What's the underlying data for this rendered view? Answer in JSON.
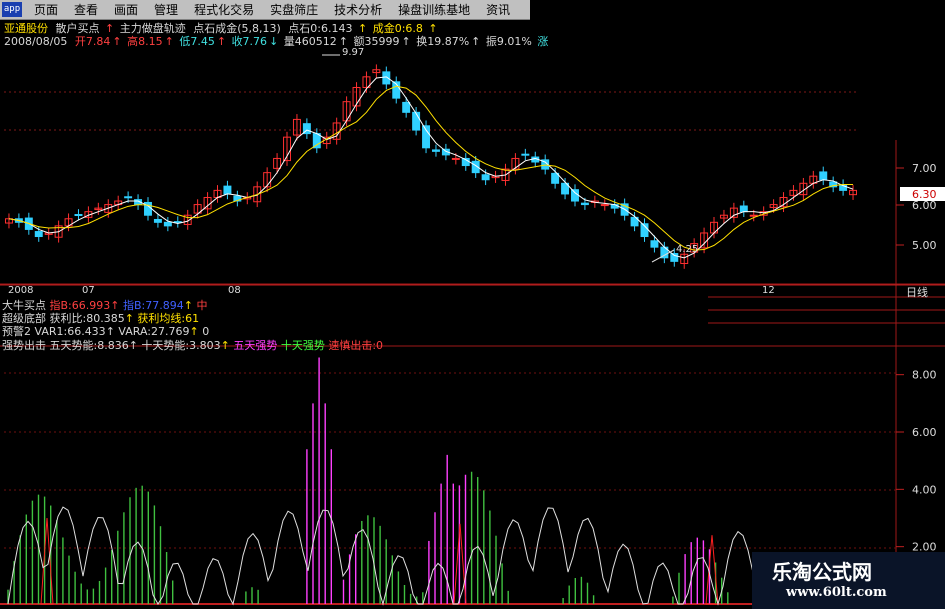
{
  "menu": {
    "logo": "app",
    "items": [
      "页面",
      "查看",
      "画面",
      "管理",
      "程式化交易",
      "实盘筛庄",
      "技术分析",
      "操盘训练基地",
      "资讯"
    ]
  },
  "header": {
    "stock_name": "亚通股份",
    "indicator_name": "散户买点",
    "overlay1": "主力做盘轨迹",
    "overlay2": "点石成金(5,8,13)",
    "dianshi": "点石0:6.143",
    "chengjin": "成金0:6.8",
    "date": "2008/08/05",
    "open": "开7.84",
    "high": "高8.15",
    "low": "低7.45",
    "close": "收7.76",
    "volume": "量460512",
    "amount": "额35999",
    "turnover": "换19.87%",
    "amplitude": "振9.01%",
    "extra": "涨"
  },
  "chart_data": [
    {
      "type": "candlestick",
      "title": "",
      "price_ticks": [
        "7.00",
        "6.00",
        "5.00"
      ],
      "current_price_label": "6.30",
      "annotations": {
        "high_label": "9.97",
        "low_label": "4.25"
      },
      "time_labels": [
        "2008",
        "07",
        "08",
        "12"
      ],
      "period_label": "日线",
      "ma_series": [
        {
          "name": "MA5",
          "color": "#ffffff"
        },
        {
          "name": "MA10",
          "color": "#ffe000"
        }
      ],
      "closes": [
        5.5,
        5.4,
        5.2,
        5.0,
        5.1,
        5.3,
        5.5,
        5.6,
        5.7,
        5.8,
        5.9,
        6.0,
        6.1,
        5.9,
        5.6,
        5.4,
        5.3,
        5.4,
        5.6,
        5.9,
        6.1,
        6.3,
        6.2,
        6.0,
        6.1,
        6.4,
        6.8,
        7.2,
        7.8,
        8.3,
        7.9,
        7.5,
        7.8,
        8.2,
        8.8,
        9.2,
        9.5,
        9.7,
        9.3,
        8.9,
        8.5,
        8.0,
        7.5,
        7.4,
        7.3,
        7.2,
        7.0,
        6.8,
        6.6,
        6.7,
        6.9,
        7.2,
        7.3,
        7.1,
        6.9,
        6.5,
        6.2,
        6.0,
        5.9,
        6.0,
        5.9,
        5.8,
        5.6,
        5.3,
        5.0,
        4.7,
        4.4,
        4.3,
        4.5,
        4.8,
        5.1,
        5.4,
        5.6,
        5.8,
        5.7,
        5.6,
        5.7,
        5.9,
        6.1,
        6.3,
        6.5,
        6.7,
        6.6,
        6.4,
        6.3,
        6.3
      ]
    },
    {
      "type": "bar",
      "title": "",
      "ylim": [
        0,
        9
      ],
      "y_ticks": [
        "8.00",
        "6.00",
        "4.00",
        "2.00"
      ],
      "series": [
        {
          "name": "五天势能",
          "color": "#ff40ff"
        },
        {
          "name": "十天势能",
          "color": "#40ff40"
        },
        {
          "name": "速慎出击",
          "color": "#ff2020"
        }
      ]
    }
  ],
  "panel2": {
    "name": "大牛买点",
    "v1": "指B:66.993",
    "v2": "指B:77.894",
    "v3": "中"
  },
  "panel3": {
    "name": "超级底部",
    "profit": "获利比:80.385",
    "avg": "获利均线:61"
  },
  "panel4": {
    "name": "预警2",
    "var1": "VAR1:66.433",
    "vara": "VARA:27.769",
    "zero": "0"
  },
  "panel5": {
    "name": "强势出击",
    "five": "五天势能:8.836",
    "ten": "十天势能:3.803",
    "five_strong": "五天强势",
    "ten_strong": "十天强势",
    "sushen": "速慎出击:0"
  },
  "watermark": {
    "cn": "乐淘公式网",
    "url": "www.60lt.com"
  }
}
